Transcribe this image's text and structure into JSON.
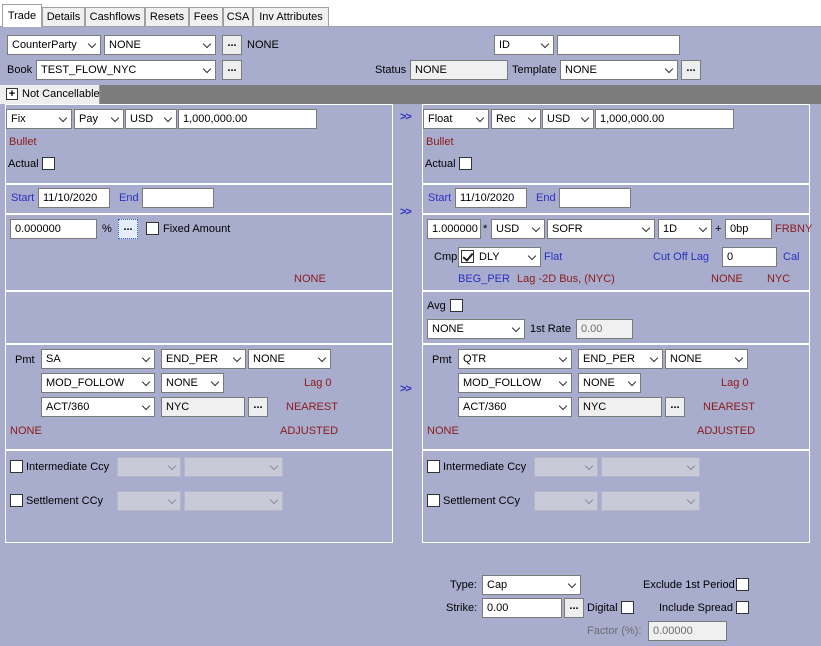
{
  "tabs": [
    "Trade",
    "Details",
    "Cashflows",
    "Resets",
    "Fees",
    "CSA",
    "Inv Attributes"
  ],
  "header": {
    "counterparty_type": "CounterParty",
    "counterparty": "NONE",
    "counterparty_name": "NONE",
    "id_type": "ID",
    "id_value": "",
    "book_label": "Book",
    "book": "TEST_FLOW_NYC",
    "status_label": "Status",
    "status": "NONE",
    "template_label": "Template",
    "template": "NONE",
    "ellipsis": "..."
  },
  "not_cancellable": "Not Cancellable",
  "arrows": ">>",
  "left": {
    "leg_type": "Fix",
    "pay_rec": "Pay",
    "currency": "USD",
    "notional": "1,000,000.00",
    "amort": "Bullet",
    "actual_label": "Actual",
    "start_label": "Start",
    "start_date": "11/10/2020",
    "end_label": "End",
    "end_date": "",
    "rate": "0.000000",
    "pct": "%",
    "fixed_amount_label": "Fixed Amount",
    "rate_none": "NONE",
    "pmt_label": "Pmt",
    "pmt_freq": "SA",
    "pmt_period": "END_PER",
    "pmt_extra": "NONE",
    "roll": "MOD_FOLLOW",
    "roll_extra": "NONE",
    "lag": "Lag 0",
    "daycount": "ACT/360",
    "calendar": "NYC",
    "nearest": "NEAREST",
    "bottom_none": "NONE",
    "adjusted": "ADJUSTED",
    "intermediate_ccy_label": "Intermediate Ccy",
    "settlement_ccy_label": "Settlement CCy"
  },
  "right": {
    "leg_type": "Float",
    "pay_rec": "Rec",
    "currency": "USD",
    "notional": "1,000,000.00",
    "amort": "Bullet",
    "actual_label": "Actual",
    "start_label": "Start",
    "start_date": "11/10/2020",
    "end_label": "End",
    "end_date": "",
    "multiplier": "1.000000",
    "times": "*",
    "index_ccy": "USD",
    "index": "SOFR",
    "tenor": "1D",
    "plus": "+",
    "spread": "0bp",
    "source": "FRBNY",
    "cmp_label": "Cmp",
    "cmp_freq": "DLY",
    "flat": "Flat",
    "cutoff_label": "Cut Off Lag",
    "cutoff_value": "0",
    "cal_label": "Cal",
    "beg_per": "BEG_PER",
    "lag_desc": "Lag -2D Bus, (NYC)",
    "reset_none": "NONE",
    "reset_cal": "NYC",
    "avg_label": "Avg",
    "avg_method": "NONE",
    "first_rate_label": "1st Rate",
    "first_rate": "0.00",
    "pmt_label": "Pmt",
    "pmt_freq": "QTR",
    "pmt_period": "END_PER",
    "pmt_extra": "NONE",
    "roll": "MOD_FOLLOW",
    "roll_extra": "NONE",
    "lag": "Lag 0",
    "daycount": "ACT/360",
    "calendar": "NYC",
    "nearest": "NEAREST",
    "bottom_none": "NONE",
    "adjusted": "ADJUSTED",
    "intermediate_ccy_label": "Intermediate Ccy",
    "settlement_ccy_label": "Settlement CCy"
  },
  "cap": {
    "type_label": "Type:",
    "type": "Cap",
    "strike_label": "Strike:",
    "strike": "0.00",
    "digital_label": "Digital",
    "exclude_label": "Exclude 1st Period",
    "include_label": "Include Spread",
    "factor_label": "Factor (%):",
    "factor": "0.00000"
  }
}
